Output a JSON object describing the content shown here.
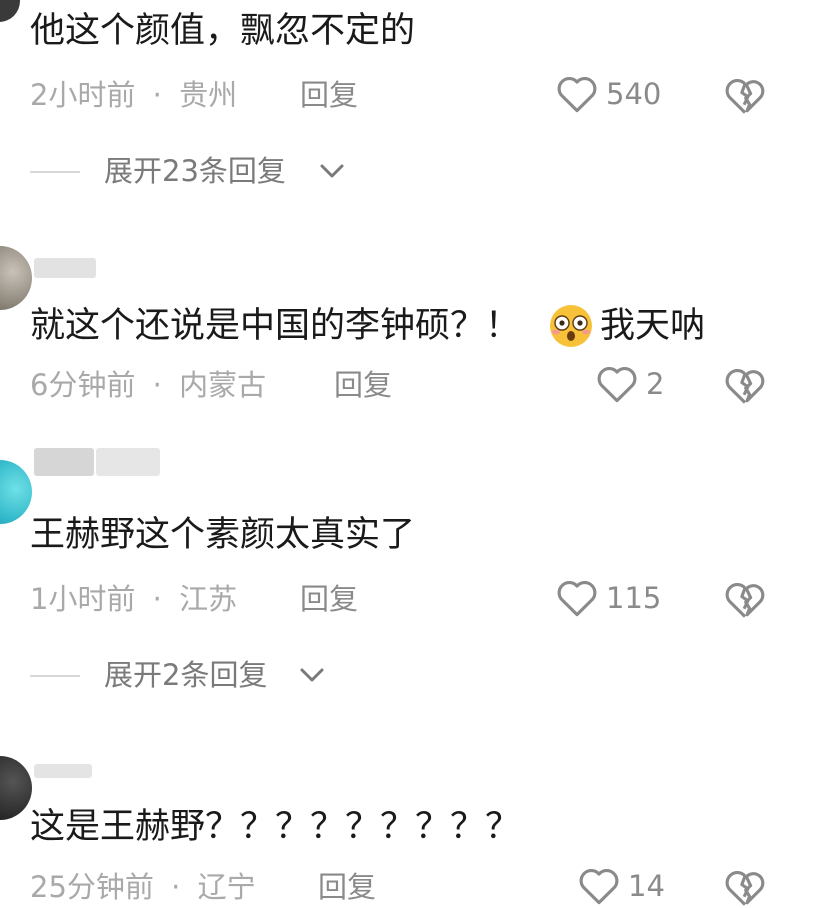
{
  "comments": [
    {
      "text": "他这个颜值，飘忽不定的",
      "time": "2小时前",
      "location": "贵州",
      "reply_label": "回复",
      "likes": "540",
      "expand_replies": "展开23条回复"
    },
    {
      "text": "就这个还说是中国的李钟硕？！",
      "text_suffix": "我天呐",
      "time": "6分钟前",
      "location": "内蒙古",
      "reply_label": "回复",
      "likes": "2"
    },
    {
      "text": "王赫野这个素颜太真实了",
      "time": "1小时前",
      "location": "江苏",
      "reply_label": "回复",
      "likes": "115",
      "expand_replies": "展开2条回复"
    },
    {
      "text": "这是王赫野？？？？？？？？？",
      "time": "25分钟前",
      "location": "辽宁",
      "reply_label": "回复",
      "likes": "14"
    }
  ],
  "separator": "·",
  "colors": {
    "text": "#1a1a1a",
    "meta": "#a9a9a9",
    "icon": "#8a8a8a"
  },
  "icons": {
    "like": "heart-outline-icon",
    "dislike": "broken-heart-icon",
    "expand": "chevron-down-icon",
    "emoji": "flushed-face-emoji"
  }
}
